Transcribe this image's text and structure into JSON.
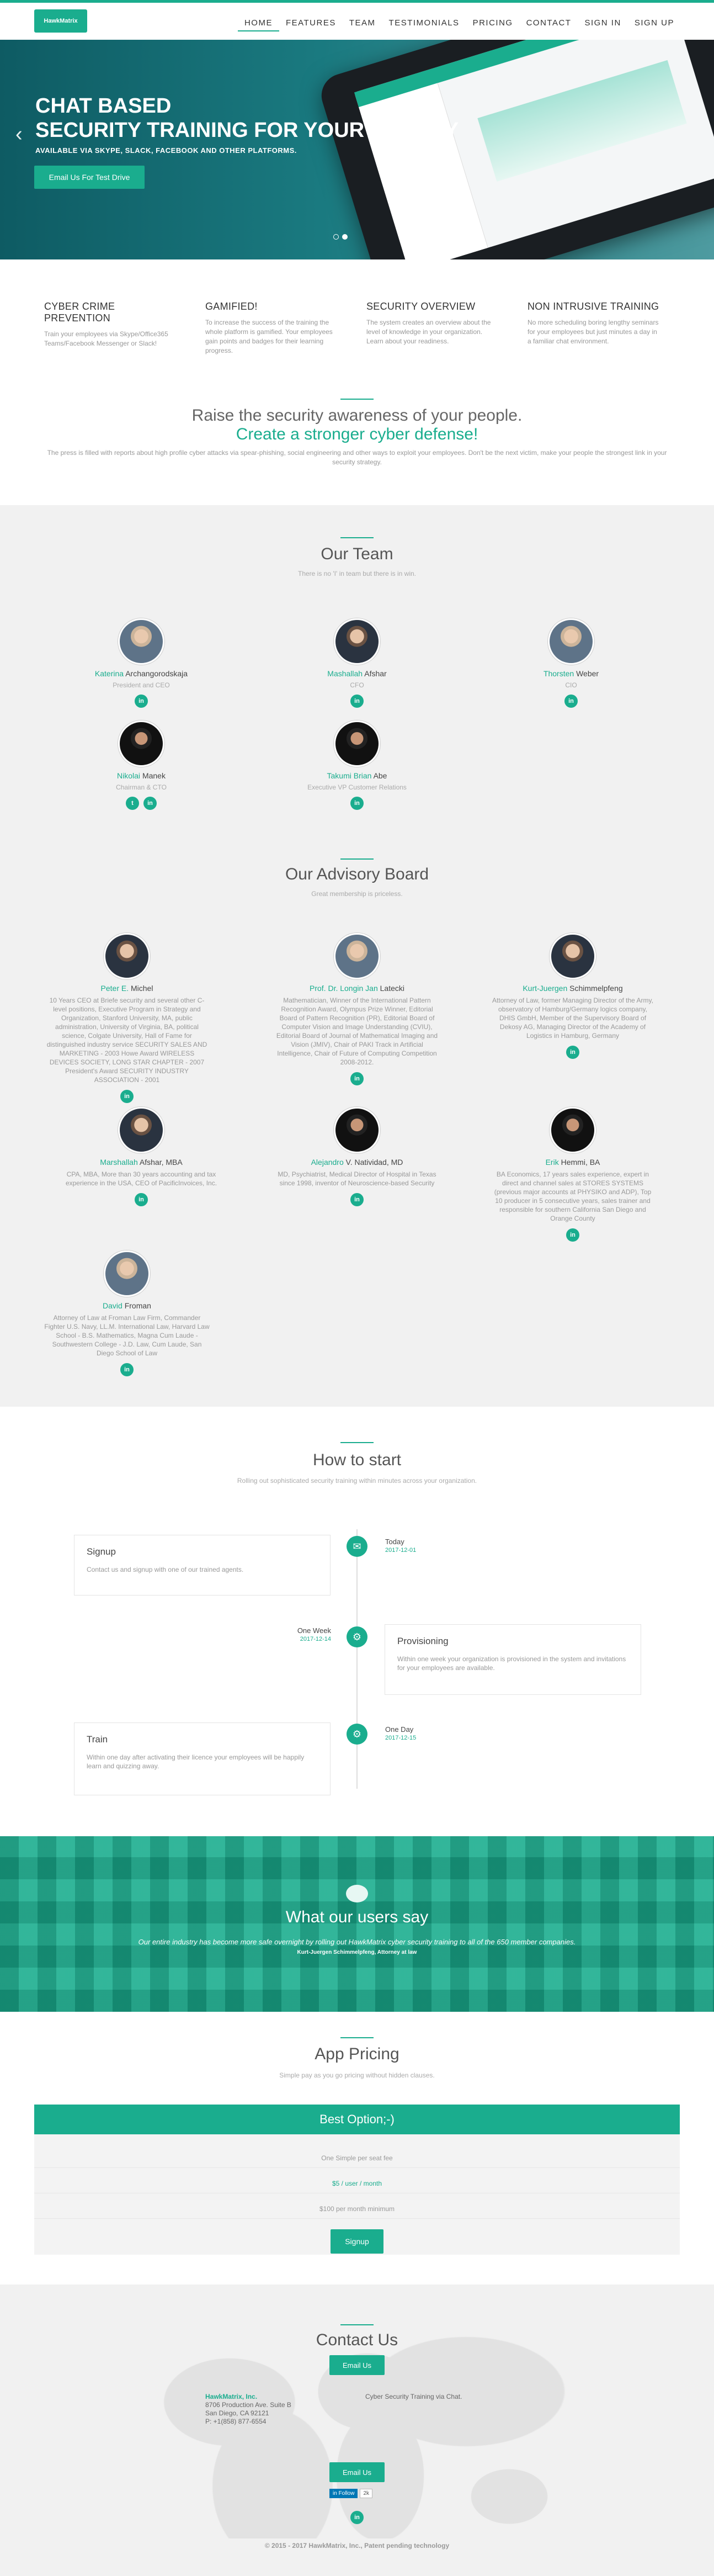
{
  "brand": {
    "logo": "HawkMatrix"
  },
  "nav": [
    "HOME",
    "FEATURES",
    "TEAM",
    "TESTIMONIALS",
    "PRICING",
    "CONTACT",
    "SIGN IN",
    "SIGN UP"
  ],
  "hero": {
    "title_line1": "CHAT BASED",
    "title_line2": "SECURITY TRAINING FOR YOUR EMPLOY",
    "subtitle": "AVAILABLE VIA SKYPE, SLACK, FACEBOOK AND OTHER PLATFORMS.",
    "cta": "Email Us For Test Drive"
  },
  "features": [
    {
      "title": "CYBER CRIME PREVENTION",
      "text": "Train your employees via Skype/Office365 Teams/Facebook Messenger or Slack!"
    },
    {
      "title": "GAMIFIED!",
      "text": "To increase the success of the training the whole platform is gamified. Your employees gain points and badges for their learning progress."
    },
    {
      "title": "SECURITY OVERVIEW",
      "text": "The system creates an overview about the level of knowledge in your organization. Learn about your readiness."
    },
    {
      "title": "NON INTRUSIVE TRAINING",
      "text": "No more scheduling boring lengthy seminars for your employees but just minutes a day in a familiar chat environment."
    }
  ],
  "raise": {
    "title1": "Raise the security awareness of your people.",
    "title2": "Create a stronger cyber defense!",
    "text": "The press is filled with reports about high profile cyber attacks via spear-phishing, social engineering and other ways to exploit your employees. Don't be the next victim, make your people the strongest link in your security strategy."
  },
  "team": {
    "title": "Our Team",
    "subtitle": "There is no 'I' in team but there is in win.",
    "members": [
      {
        "first": "Katerina",
        "last": "Archangorodskaja",
        "role": "President and CEO",
        "socials": [
          "in"
        ]
      },
      {
        "first": "Mashallah",
        "last": "Afshar",
        "role": "CFO",
        "socials": [
          "in"
        ]
      },
      {
        "first": "Thorsten",
        "last": "Weber",
        "role": "CIO",
        "socials": [
          "in"
        ]
      },
      {
        "first": "Nikolai",
        "last": "Manek",
        "role": "Chairman & CTO",
        "socials": [
          "t",
          "in"
        ]
      },
      {
        "first": "Takumi Brian",
        "last": "Abe",
        "role": "Executive VP Customer Relations",
        "socials": [
          "in"
        ]
      }
    ]
  },
  "advisory": {
    "title": "Our Advisory Board",
    "subtitle": "Great membership is priceless.",
    "members": [
      {
        "first": "Peter E.",
        "last": "Michel",
        "bio": "10 Years CEO at Briefe security and several other C-level positions, Executive Program in Strategy and Organization, Stanford University, MA, public administration, University of Virginia, BA, political science, Colgate University, Hall of Fame for distinguished industry service SECURITY SALES AND MARKETING - 2003 Howe Award WIRELESS DEVICES SOCIETY, LONG STAR CHAPTER - 2007 President's Award SECURITY INDUSTRY ASSOCIATION - 2001"
      },
      {
        "first": "Prof. Dr. Longin Jan",
        "last": "Latecki",
        "bio": "Mathematician, Winner of the International Pattern Recognition Award, Olympus Prize Winner, Editorial Board of Pattern Recognition (PR), Editorial Board of Computer Vision and Image Understanding (CVIU), Editorial Board of Journal of Mathematical Imaging and Vision (JMIV), Chair of PAKI Track in Artificial Intelligence, Chair of Future of Computing Competition 2008-2012."
      },
      {
        "first": "Kurt-Juergen",
        "last": "Schimmelpfeng",
        "bio": "Attorney of Law, former Managing Director of the Army, observatory of Hamburg/Germany logics company, DHIS GmbH, Member of the Supervisory Board of Dekosy AG, Managing Director of the Academy of Logistics in Hamburg, Germany"
      },
      {
        "first": "Marshallah",
        "last": "Afshar, MBA",
        "bio": "CPA, MBA, More than 30 years accounting and tax experience in the USA, CEO of PacificInvoices, Inc."
      },
      {
        "first": "Alejandro",
        "last": "V. Natividad, MD",
        "bio": "MD, Psychiatrist, Medical Director of Hospital in Texas since 1998, inventor of Neuroscience-based Security"
      },
      {
        "first": "Erik",
        "last": "Hemmi, BA",
        "bio": "BA Economics, 17 years sales experience, expert in direct and channel sales at STORES SYSTEMS (previous major accounts at PHYSIKO and ADP), Top 10 producer in 5 consecutive years, sales trainer and responsible for southern California San Diego and Orange County"
      },
      {
        "first": "David",
        "last": "Froman",
        "bio": "Attorney of Law at Froman Law Firm, Commander Fighter U.S. Navy, LL.M. International Law, Harvard Law School - B.S. Mathematics, Magna Cum Laude - Southwestern College - J.D. Law, Cum Laude, San Diego School of Law"
      }
    ]
  },
  "how": {
    "title": "How to start",
    "subtitle": "Rolling out sophisticated security training within minutes across your organization.",
    "steps": [
      {
        "title": "Signup",
        "text": "Contact us and signup with one of our trained agents.",
        "when": "Today",
        "date": "2017-12-01",
        "icon": "chat-icon"
      },
      {
        "title": "Provisioning",
        "text": "Within one week your organization is provisioned in the system and invitations for your employees are available.",
        "when": "One Week",
        "date": "2017-12-14",
        "icon": "gear-icon"
      },
      {
        "title": "Train",
        "text": "Within one day after activating their licence your employees will be happily learn and quizzing away.",
        "when": "One Day",
        "date": "2017-12-15",
        "icon": "gears-icon"
      }
    ]
  },
  "testimonial": {
    "title": "What our users say",
    "quote": "Our entire industry has become more safe overnight by rolling out HawkMatrix cyber security training to all of the 650 member companies.",
    "author": "Kurt-Juergen Schimmelpfeng, Attorney at law"
  },
  "pricing": {
    "title": "App Pricing",
    "subtitle": "Simple pay as you go pricing without hidden clauses.",
    "plan": "Best Option;-)",
    "rows": [
      "One Simple per seat fee",
      "$5 / user / month",
      "$100 per month minimum"
    ],
    "button": "Signup"
  },
  "contact": {
    "title": "Contact Us",
    "button": "Email Us",
    "company": "HawkMatrix, Inc.",
    "address1": "8706 Production Ave. Suite B",
    "address2": "San Diego, CA 92121",
    "phone": "P: +1(858) 877-6554",
    "tagline": "Cyber Security Training via Chat.",
    "follow": "Follow",
    "follow_count": "2k",
    "copyright": "© 2015 - 2017 HawkMatrix, Inc., Patent pending technology"
  }
}
